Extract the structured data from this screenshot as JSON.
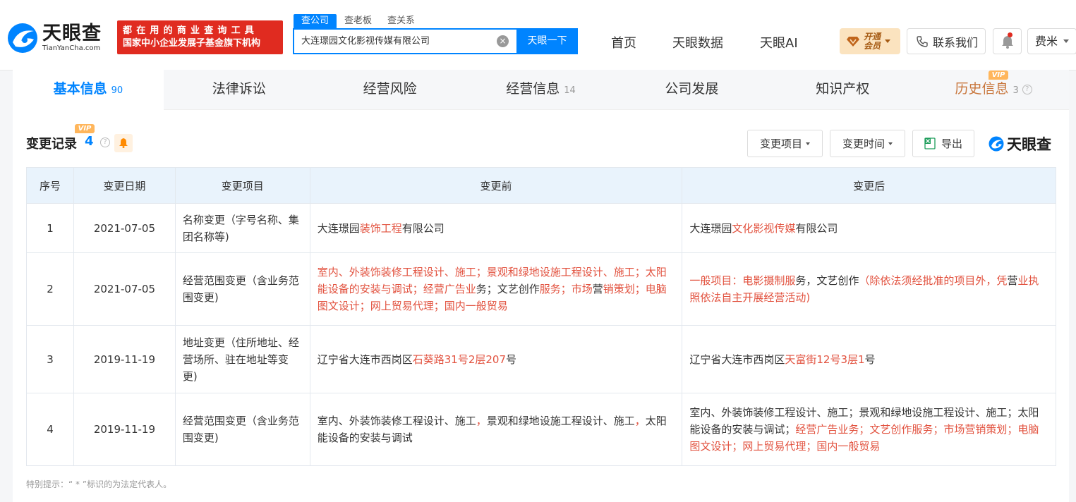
{
  "header": {
    "logo_cn": "天眼查",
    "logo_en": "TianYanCha.com",
    "slogan_line1": "都在用的商业查询工具",
    "slogan_line2": "国家中小企业发展子基金旗下机构",
    "search_tabs": [
      "查公司",
      "查老板",
      "查关系"
    ],
    "search_value": "大连璟园文化影视传媒有限公司",
    "search_button": "天眼一下",
    "nav": [
      "首页",
      "天眼数据",
      "天眼AI"
    ],
    "vip_label_1": "开通",
    "vip_label_2": "会员",
    "contact_label": "联系我们",
    "user_name": "费米"
  },
  "tabs": [
    {
      "label": "基本信息",
      "count": "90"
    },
    {
      "label": "法律诉讼",
      "count": ""
    },
    {
      "label": "经营风险",
      "count": ""
    },
    {
      "label": "经营信息",
      "count": "14"
    },
    {
      "label": "公司发展",
      "count": ""
    },
    {
      "label": "知识产权",
      "count": ""
    },
    {
      "label": "历史信息",
      "count": "3"
    }
  ],
  "tab_vip_badge": "VIP",
  "section": {
    "title": "变更记录",
    "count": "4",
    "vip_badge": "VIP",
    "filter_item": "变更项目",
    "filter_time": "变更时间",
    "export": "导出",
    "watermark": "天眼查"
  },
  "table": {
    "headers": [
      "序号",
      "变更日期",
      "变更项目",
      "变更前",
      "变更后"
    ],
    "rows": [
      {
        "no": "1",
        "date": "2021-07-05",
        "item": "名称变更（字号名称、集团名称等)",
        "before": [
          [
            "大连璟园",
            false
          ],
          [
            "装饰工程",
            true
          ],
          [
            "有限公司",
            false
          ]
        ],
        "after": [
          [
            "大连璟园",
            false
          ],
          [
            "文化影视传媒",
            true
          ],
          [
            "有限公司",
            false
          ]
        ]
      },
      {
        "no": "2",
        "date": "2021-07-05",
        "item": "经营范围变更（含业务范围变更)",
        "before": [
          [
            "室内、外装饰装修工程设计、施工；景观和绿地设施工程设计、施工；太阳能设备的安装与调试；经营广告业",
            true
          ],
          [
            "务；文艺创作",
            false
          ],
          [
            "服务；市场",
            true
          ],
          [
            "营",
            false
          ],
          [
            "销策划；电脑图文设计；网上贸易代理；国内一般贸易",
            true
          ]
        ],
        "after": [
          [
            "一般项目：电影摄制服",
            true
          ],
          [
            "务，文艺创作",
            false
          ],
          [
            "（除依法须经批准的项目外，凭",
            true
          ],
          [
            "营",
            false
          ],
          [
            "业执照依法自主开展经营活动)",
            true
          ]
        ]
      },
      {
        "no": "3",
        "date": "2019-11-19",
        "item": "地址变更（住所地址、经营场所、驻在地址等变更)",
        "before": [
          [
            "辽宁省大连市西岗区",
            false
          ],
          [
            "石葵路31号2层207",
            true
          ],
          [
            "号",
            false
          ]
        ],
        "after": [
          [
            "辽宁省大连市西岗区",
            false
          ],
          [
            "天富街12号3层1",
            true
          ],
          [
            "号",
            false
          ]
        ]
      },
      {
        "no": "4",
        "date": "2019-11-19",
        "item": "经营范围变更（含业务范围变更)",
        "before": [
          [
            "室内、外装饰装修工程设计、施工",
            false
          ],
          [
            "，",
            true
          ],
          [
            "景观和绿地设施工程设计、施工",
            false
          ],
          [
            "，",
            true
          ],
          [
            "太阳能设备的安装与调试",
            false
          ]
        ],
        "after": [
          [
            "室内、外装饰装修工程设计、施工；景观和绿地设施工程设计、施工；太阳能设备的安装与调试；",
            false
          ],
          [
            "经营广告业务；文艺创作服务；市场营销策划；电脑图文设计；网上贸易代理；国内一般贸易",
            true
          ]
        ]
      }
    ]
  },
  "note": "特别提示：“ * ”标识的为法定代表人。",
  "colors": {
    "brand_blue": "#0084ff",
    "highlight_red": "#e2523f",
    "slogan_red": "#e02b20",
    "vip_gold": "#fbe3bf"
  }
}
